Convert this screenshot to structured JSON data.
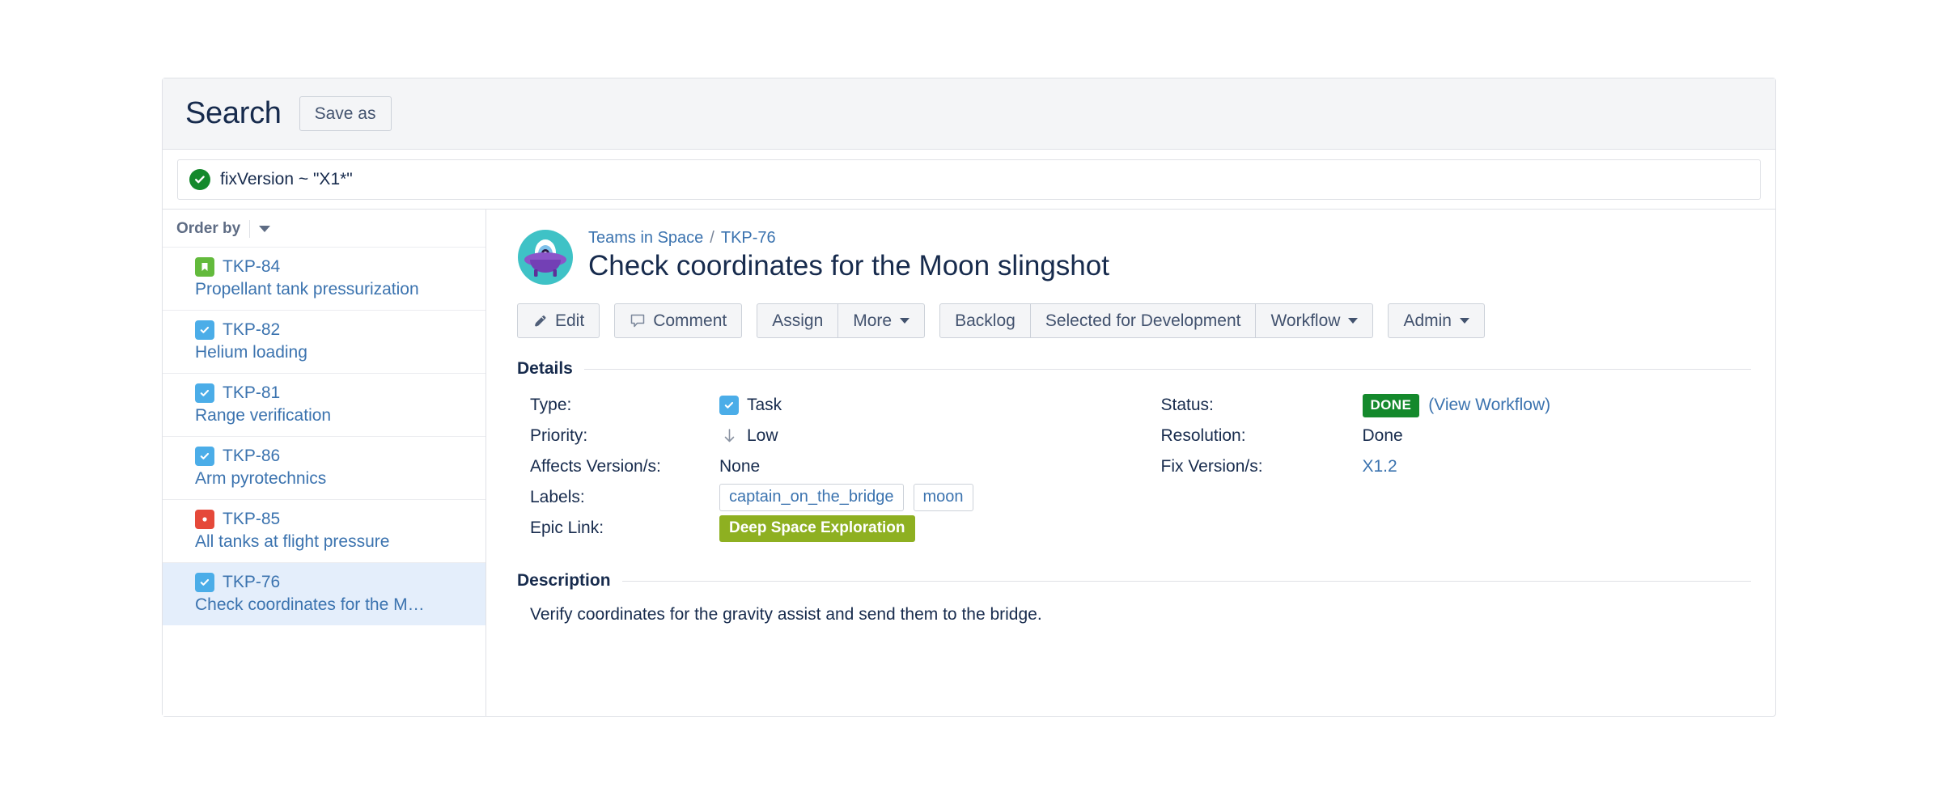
{
  "header": {
    "title": "Search",
    "save_as_label": "Save as"
  },
  "filter": {
    "status_icon": "check-circle-icon",
    "jql": "fixVersion ~ \"X1*\""
  },
  "issue_list": {
    "order_by_label": "Order by",
    "order_by_icon": "chevron-down-icon",
    "items": [
      {
        "key": "TKP-84",
        "summary": "Propellant tank pressurization",
        "type": "story",
        "type_icon": "story-icon",
        "selected": false
      },
      {
        "key": "TKP-82",
        "summary": "Helium loading",
        "type": "task",
        "type_icon": "task-icon",
        "selected": false
      },
      {
        "key": "TKP-81",
        "summary": "Range verification",
        "type": "task",
        "type_icon": "task-icon",
        "selected": false
      },
      {
        "key": "TKP-86",
        "summary": "Arm pyrotechnics",
        "type": "task",
        "type_icon": "task-icon",
        "selected": false
      },
      {
        "key": "TKP-85",
        "summary": "All tanks at flight pressure",
        "type": "bug",
        "type_icon": "bug-icon",
        "selected": false
      },
      {
        "key": "TKP-76",
        "summary": "Check coordinates for the M…",
        "type": "task",
        "type_icon": "task-icon",
        "selected": true
      }
    ]
  },
  "issue": {
    "avatar_icon": "teams-in-space-project-avatar",
    "breadcrumb_project": "Teams in Space",
    "breadcrumb_separator": "/",
    "breadcrumb_key": "TKP-76",
    "title": "Check coordinates for the Moon slingshot",
    "toolbar": {
      "edit_label": "Edit",
      "edit_icon": "pencil-icon",
      "comment_label": "Comment",
      "comment_icon": "speech-bubble-icon",
      "assign_label": "Assign",
      "more_label": "More",
      "backlog_label": "Backlog",
      "selected_for_development_label": "Selected for Development",
      "workflow_label": "Workflow",
      "admin_label": "Admin"
    },
    "details_heading": "Details",
    "details_left": [
      {
        "label": "Type:",
        "value": "Task",
        "icon": "task-icon"
      },
      {
        "label": "Priority:",
        "value": "Low",
        "icon": "arrow-down-icon"
      },
      {
        "label": "Affects Version/s:",
        "value": "None",
        "icon": ""
      },
      {
        "label": "Labels:",
        "value": "",
        "icon": ""
      },
      {
        "label": "Epic Link:",
        "value": "",
        "icon": ""
      }
    ],
    "labels": [
      "captain_on_the_bridge",
      "moon"
    ],
    "epic_link": "Deep Space Exploration",
    "details_right": [
      {
        "label": "Status:",
        "value": "DONE",
        "extra": "(View Workflow)"
      },
      {
        "label": "Resolution:",
        "value": "Done",
        "extra": ""
      },
      {
        "label": "Fix Version/s:",
        "value": "X1.2",
        "extra": ""
      }
    ],
    "description_heading": "Description",
    "description_body": "Verify coordinates for the gravity assist and send them to the bridge."
  },
  "colors": {
    "link": "#3b73af",
    "status_done": "#14892c",
    "epic": "#8eb021",
    "task_blue": "#4bade8",
    "story_green": "#63ba3c",
    "bug_red": "#e5493a",
    "selected_row": "#e4eefb"
  }
}
